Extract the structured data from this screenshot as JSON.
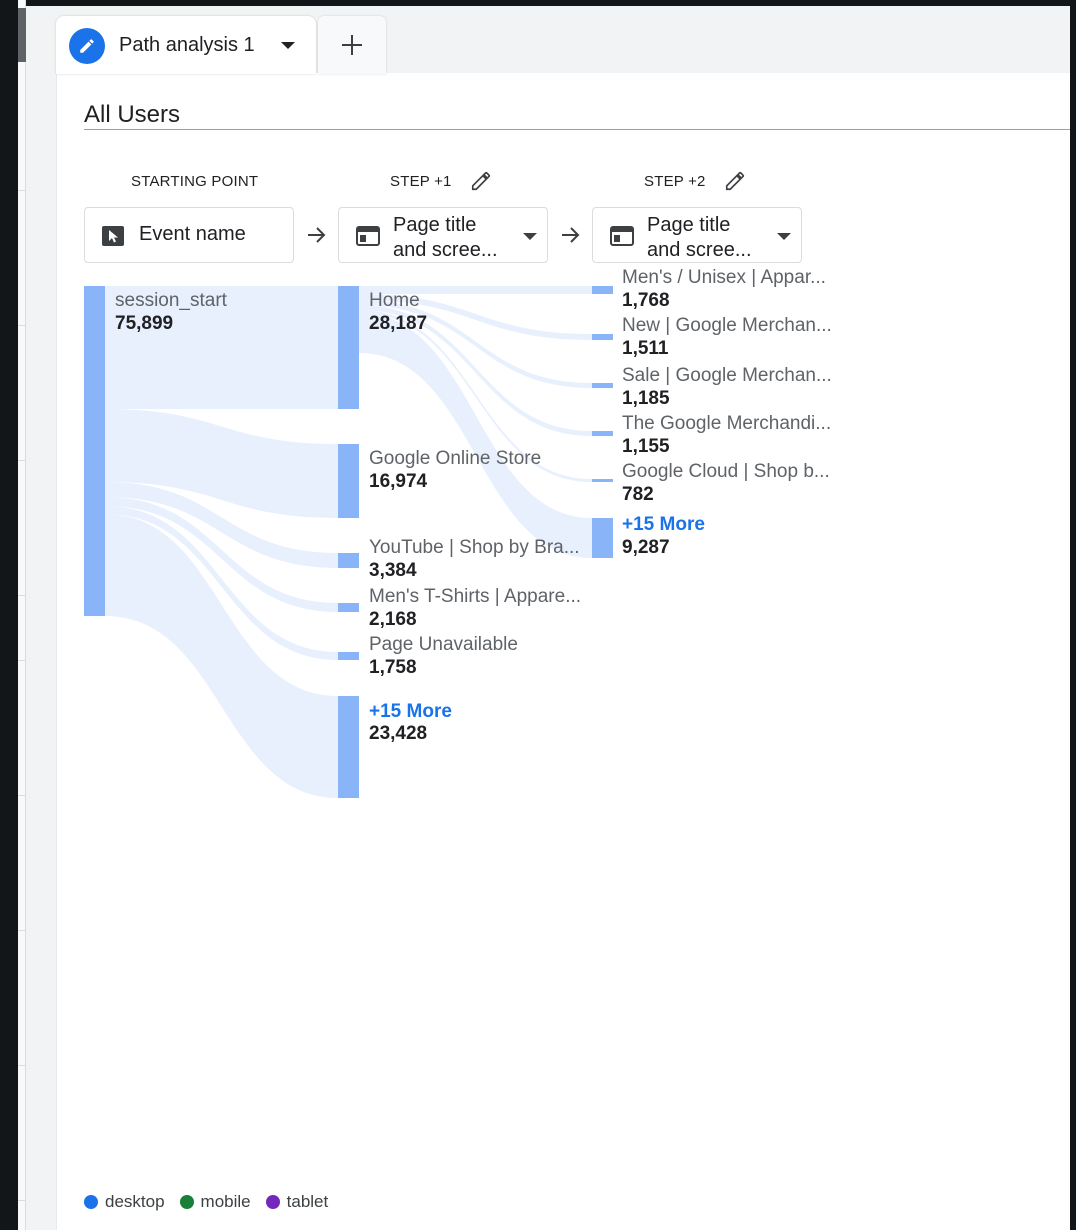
{
  "tab": {
    "title": "Path analysis 1",
    "edit_icon": "pencil-icon",
    "caret_icon": "caret-down-icon"
  },
  "add_tab_icon": "plus-icon",
  "segment": {
    "label": "All Users"
  },
  "columns": [
    {
      "heading": "STARTING POINT",
      "selector_label": "Event name",
      "selector_icon": "cursor-icon"
    },
    {
      "heading": "STEP +1",
      "selector_label": "Page title and scree...",
      "selector_line1": "Page title",
      "selector_line2": "and scree...",
      "selector_icon": "window-icon",
      "edit_icon": "pencil-icon"
    },
    {
      "heading": "STEP +2",
      "selector_label": "Page title and scree...",
      "selector_line1": "Page title",
      "selector_line2": "and scree...",
      "selector_icon": "window-icon",
      "edit_icon": "pencil-icon"
    }
  ],
  "start_node": {
    "label": "session_start",
    "value": "75,899"
  },
  "step1_nodes": [
    {
      "label": "Home",
      "value": "28,187"
    },
    {
      "label": "Google Online Store",
      "value": "16,974"
    },
    {
      "label": "YouTube | Shop by Bra...",
      "value": "3,384"
    },
    {
      "label": "Men's T-Shirts | Appare...",
      "value": "2,168"
    },
    {
      "label": "Page Unavailable",
      "value": "1,758"
    },
    {
      "label": "+15 More",
      "value": "23,428"
    }
  ],
  "step2_nodes": [
    {
      "label": "Men's / Unisex | Appar...",
      "value": "1,768"
    },
    {
      "label": "New | Google Merchan...",
      "value": "1,511"
    },
    {
      "label": "Sale | Google Merchan...",
      "value": "1,185"
    },
    {
      "label": "The Google Merchandi...",
      "value": "1,155"
    },
    {
      "label": "Google Cloud | Shop b...",
      "value": "782"
    },
    {
      "label": "+15 More",
      "value": "9,287"
    }
  ],
  "legend": [
    {
      "label": "desktop",
      "color": "#1a73e8"
    },
    {
      "label": "mobile",
      "color": "#188038"
    },
    {
      "label": "tablet",
      "color": "#7627bb"
    }
  ],
  "colors": {
    "bar": "#8ab4f8",
    "flow": "#e8f0fe",
    "accent": "#1a73e8"
  }
}
